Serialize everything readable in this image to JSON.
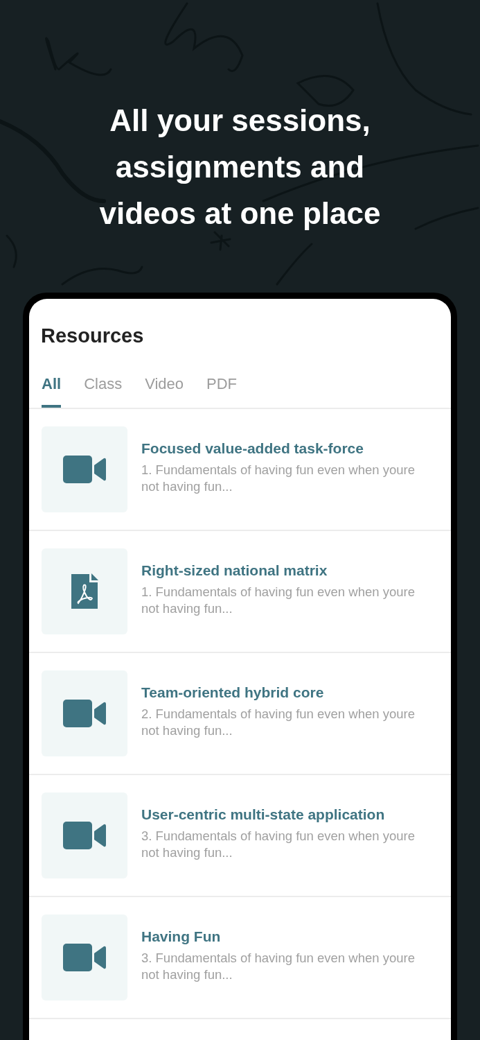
{
  "headline": "All your sessions, assignments and videos at one place",
  "screen": {
    "title": "Resources",
    "tabs": [
      {
        "label": "All",
        "selected": true
      },
      {
        "label": "Class",
        "selected": false
      },
      {
        "label": "Video",
        "selected": false
      },
      {
        "label": "PDF",
        "selected": false
      }
    ],
    "items": [
      {
        "kind": "video",
        "title": "Focused value-added task-force",
        "description": "1. Fundamentals of having fun even when youre not having fun..."
      },
      {
        "kind": "pdf",
        "title": "Right-sized national matrix",
        "description": "1. Fundamentals of having fun even when youre not having fun..."
      },
      {
        "kind": "video",
        "title": "Team-oriented hybrid core",
        "description": "2. Fundamentals of having fun even when youre not having fun..."
      },
      {
        "kind": "video",
        "title": "User-centric multi-state application",
        "description": "3. Fundamentals of having fun even when youre not having fun..."
      },
      {
        "kind": "video",
        "title": "Having Fun",
        "description": "3. Fundamentals of having fun even when youre not having fun..."
      }
    ]
  }
}
